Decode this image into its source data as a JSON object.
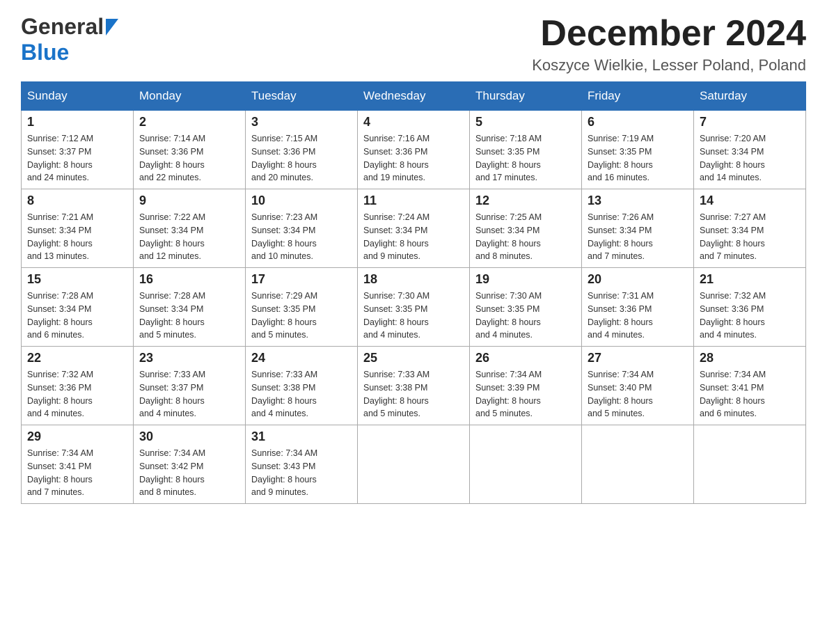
{
  "header": {
    "logo_general": "General",
    "logo_blue": "Blue",
    "title": "December 2024",
    "subtitle": "Koszyce Wielkie, Lesser Poland, Poland"
  },
  "days_of_week": [
    "Sunday",
    "Monday",
    "Tuesday",
    "Wednesday",
    "Thursday",
    "Friday",
    "Saturday"
  ],
  "weeks": [
    [
      {
        "day": "1",
        "sunrise": "7:12 AM",
        "sunset": "3:37 PM",
        "daylight": "8 hours and 24 minutes."
      },
      {
        "day": "2",
        "sunrise": "7:14 AM",
        "sunset": "3:36 PM",
        "daylight": "8 hours and 22 minutes."
      },
      {
        "day": "3",
        "sunrise": "7:15 AM",
        "sunset": "3:36 PM",
        "daylight": "8 hours and 20 minutes."
      },
      {
        "day": "4",
        "sunrise": "7:16 AM",
        "sunset": "3:36 PM",
        "daylight": "8 hours and 19 minutes."
      },
      {
        "day": "5",
        "sunrise": "7:18 AM",
        "sunset": "3:35 PM",
        "daylight": "8 hours and 17 minutes."
      },
      {
        "day": "6",
        "sunrise": "7:19 AM",
        "sunset": "3:35 PM",
        "daylight": "8 hours and 16 minutes."
      },
      {
        "day": "7",
        "sunrise": "7:20 AM",
        "sunset": "3:34 PM",
        "daylight": "8 hours and 14 minutes."
      }
    ],
    [
      {
        "day": "8",
        "sunrise": "7:21 AM",
        "sunset": "3:34 PM",
        "daylight": "8 hours and 13 minutes."
      },
      {
        "day": "9",
        "sunrise": "7:22 AM",
        "sunset": "3:34 PM",
        "daylight": "8 hours and 12 minutes."
      },
      {
        "day": "10",
        "sunrise": "7:23 AM",
        "sunset": "3:34 PM",
        "daylight": "8 hours and 10 minutes."
      },
      {
        "day": "11",
        "sunrise": "7:24 AM",
        "sunset": "3:34 PM",
        "daylight": "8 hours and 9 minutes."
      },
      {
        "day": "12",
        "sunrise": "7:25 AM",
        "sunset": "3:34 PM",
        "daylight": "8 hours and 8 minutes."
      },
      {
        "day": "13",
        "sunrise": "7:26 AM",
        "sunset": "3:34 PM",
        "daylight": "8 hours and 7 minutes."
      },
      {
        "day": "14",
        "sunrise": "7:27 AM",
        "sunset": "3:34 PM",
        "daylight": "8 hours and 7 minutes."
      }
    ],
    [
      {
        "day": "15",
        "sunrise": "7:28 AM",
        "sunset": "3:34 PM",
        "daylight": "8 hours and 6 minutes."
      },
      {
        "day": "16",
        "sunrise": "7:28 AM",
        "sunset": "3:34 PM",
        "daylight": "8 hours and 5 minutes."
      },
      {
        "day": "17",
        "sunrise": "7:29 AM",
        "sunset": "3:35 PM",
        "daylight": "8 hours and 5 minutes."
      },
      {
        "day": "18",
        "sunrise": "7:30 AM",
        "sunset": "3:35 PM",
        "daylight": "8 hours and 4 minutes."
      },
      {
        "day": "19",
        "sunrise": "7:30 AM",
        "sunset": "3:35 PM",
        "daylight": "8 hours and 4 minutes."
      },
      {
        "day": "20",
        "sunrise": "7:31 AM",
        "sunset": "3:36 PM",
        "daylight": "8 hours and 4 minutes."
      },
      {
        "day": "21",
        "sunrise": "7:32 AM",
        "sunset": "3:36 PM",
        "daylight": "8 hours and 4 minutes."
      }
    ],
    [
      {
        "day": "22",
        "sunrise": "7:32 AM",
        "sunset": "3:36 PM",
        "daylight": "8 hours and 4 minutes."
      },
      {
        "day": "23",
        "sunrise": "7:33 AM",
        "sunset": "3:37 PM",
        "daylight": "8 hours and 4 minutes."
      },
      {
        "day": "24",
        "sunrise": "7:33 AM",
        "sunset": "3:38 PM",
        "daylight": "8 hours and 4 minutes."
      },
      {
        "day": "25",
        "sunrise": "7:33 AM",
        "sunset": "3:38 PM",
        "daylight": "8 hours and 5 minutes."
      },
      {
        "day": "26",
        "sunrise": "7:34 AM",
        "sunset": "3:39 PM",
        "daylight": "8 hours and 5 minutes."
      },
      {
        "day": "27",
        "sunrise": "7:34 AM",
        "sunset": "3:40 PM",
        "daylight": "8 hours and 5 minutes."
      },
      {
        "day": "28",
        "sunrise": "7:34 AM",
        "sunset": "3:41 PM",
        "daylight": "8 hours and 6 minutes."
      }
    ],
    [
      {
        "day": "29",
        "sunrise": "7:34 AM",
        "sunset": "3:41 PM",
        "daylight": "8 hours and 7 minutes."
      },
      {
        "day": "30",
        "sunrise": "7:34 AM",
        "sunset": "3:42 PM",
        "daylight": "8 hours and 8 minutes."
      },
      {
        "day": "31",
        "sunrise": "7:34 AM",
        "sunset": "3:43 PM",
        "daylight": "8 hours and 9 minutes."
      },
      null,
      null,
      null,
      null
    ]
  ],
  "labels": {
    "sunrise": "Sunrise: ",
    "sunset": "Sunset: ",
    "daylight": "Daylight: "
  }
}
